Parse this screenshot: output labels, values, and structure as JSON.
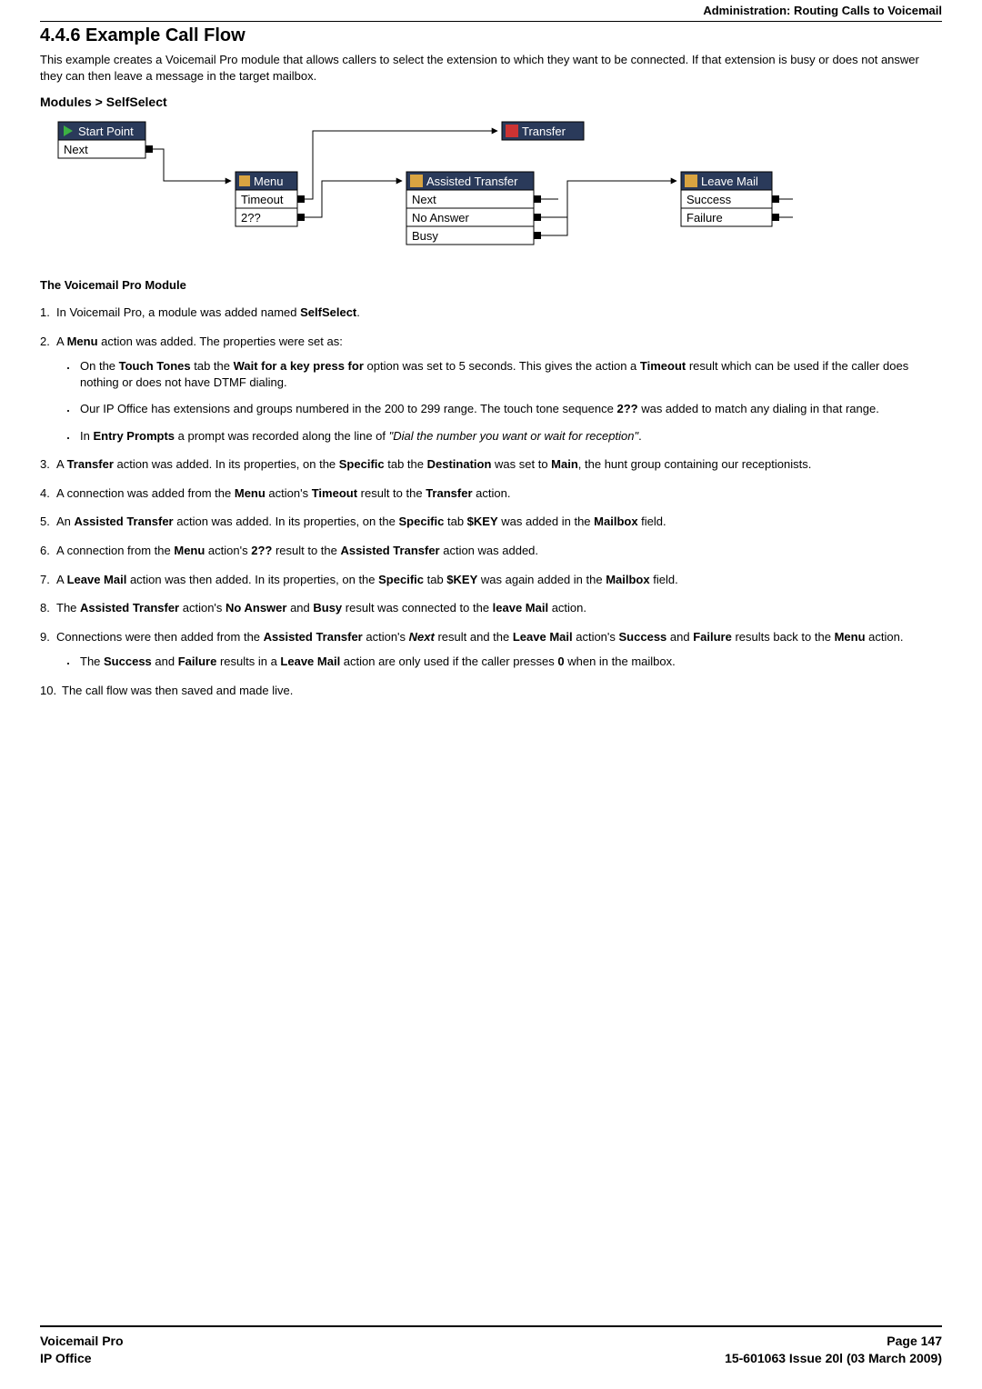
{
  "header": {
    "breadcrumb": "Administration: Routing Calls to Voicemail"
  },
  "title": "4.4.6 Example Call Flow",
  "intro": "This example creates a Voicemail Pro module that allows callers to select the extension to which they want to be connected. If that extension is busy or does not answer they can then leave a message in the target mailbox.",
  "diagram": {
    "breadcrumb": "Modules > SelfSelect",
    "start_point": "Start Point",
    "start_next": "Next",
    "menu": "Menu",
    "menu_timeout": "Timeout",
    "menu_pattern": "2??",
    "transfer": "Transfer",
    "assisted_transfer": "Assisted Transfer",
    "at_next": "Next",
    "at_no_answer": "No Answer",
    "at_busy": "Busy",
    "leave_mail": "Leave Mail",
    "lm_success": "Success",
    "lm_failure": "Failure"
  },
  "section_title": "The Voicemail Pro Module",
  "steps": {
    "s1_a": "In Voicemail Pro, a module was added named ",
    "s1_b": "SelfSelect",
    "s1_c": ".",
    "s2_a": "A ",
    "s2_b": "Menu",
    "s2_c": " action was added. The properties were set as:",
    "s2_sub": {
      "a1": "On the ",
      "a2": "Touch Tones",
      "a3": " tab the ",
      "a4": "Wait for a key press for",
      "a5": " option was set to 5 seconds. This gives the action a ",
      "a6": "Timeout",
      "a7": " result which can be used if the caller does nothing or does not have DTMF dialing.",
      "b1": "Our IP Office has extensions and groups numbered in the 200 to 299 range. The touch tone sequence ",
      "b2": "2??",
      "b3": " was added to match any dialing in that range.",
      "c1": "In ",
      "c2": "Entry Prompts",
      "c3": " a prompt was recorded along the line of ",
      "c4": "\"Dial the number you want or wait for reception\"",
      "c5": "."
    },
    "s3_a": "A ",
    "s3_b": "Transfer",
    "s3_c": " action was added. In its properties, on the ",
    "s3_d": "Specific",
    "s3_e": " tab the ",
    "s3_f": "Destination",
    "s3_g": " was set to ",
    "s3_h": "Main",
    "s3_i": ", the hunt group containing our receptionists.",
    "s4_a": "A connection was added from the ",
    "s4_b": "Menu",
    "s4_c": " action's ",
    "s4_d": "Timeout",
    "s4_e": " result to the ",
    "s4_f": "Transfer",
    "s4_g": " action.",
    "s5_a": "An ",
    "s5_b": "Assisted Transfer",
    "s5_c": " action was added. In its properties, on the ",
    "s5_d": "Specific",
    "s5_e": " tab  ",
    "s5_f": "$KEY",
    "s5_g": " was added in the ",
    "s5_h": "Mailbox",
    "s5_i": " field.",
    "s6_a": "A connection from the ",
    "s6_b": "Menu",
    "s6_c": " action's ",
    "s6_d": "2??",
    "s6_e": " result to the ",
    "s6_f": "Assisted Transfer",
    "s6_g": " action was added.",
    "s7_a": "A ",
    "s7_b": "Leave Mail",
    "s7_c": " action was then added. In its properties, on the ",
    "s7_d": "Specific",
    "s7_e": " tab ",
    "s7_f": "$KEY",
    "s7_g": " was again added in the ",
    "s7_h": "Mailbox",
    "s7_i": " field.",
    "s8_a": "The ",
    "s8_b": "Assisted Transfer",
    "s8_c": " action's ",
    "s8_d": "No Answer",
    "s8_e": " and ",
    "s8_f": "Busy",
    "s8_g": " result was connected to the ",
    "s8_h": "leave Mail",
    "s8_i": " action.",
    "s9_a": "Connections were then added from the ",
    "s9_b": "Assisted Transfer",
    "s9_c": " action's ",
    "s9_d": "Next",
    "s9_e": " result and the ",
    "s9_f": "Leave Mail",
    "s9_g": " action's ",
    "s9_h": "Success",
    "s9_i": " and ",
    "s9_j": "Failure",
    "s9_k": " results back to the ",
    "s9_l": "Menu",
    "s9_m": " action.",
    "s9_sub_a": "The ",
    "s9_sub_b": "Success",
    "s9_sub_c": " and ",
    "s9_sub_d": "Failure",
    "s9_sub_e": " results in a ",
    "s9_sub_f": "Leave Mail",
    "s9_sub_g": " action are only used if the caller presses ",
    "s9_sub_h": "0",
    "s9_sub_i": " when in the mailbox.",
    "s10": "The call flow was then saved and made live."
  },
  "footer": {
    "left1": "Voicemail Pro",
    "left2": "IP Office",
    "right1": "Page 147",
    "right2": "15-601063 Issue 20l (03 March 2009)"
  }
}
